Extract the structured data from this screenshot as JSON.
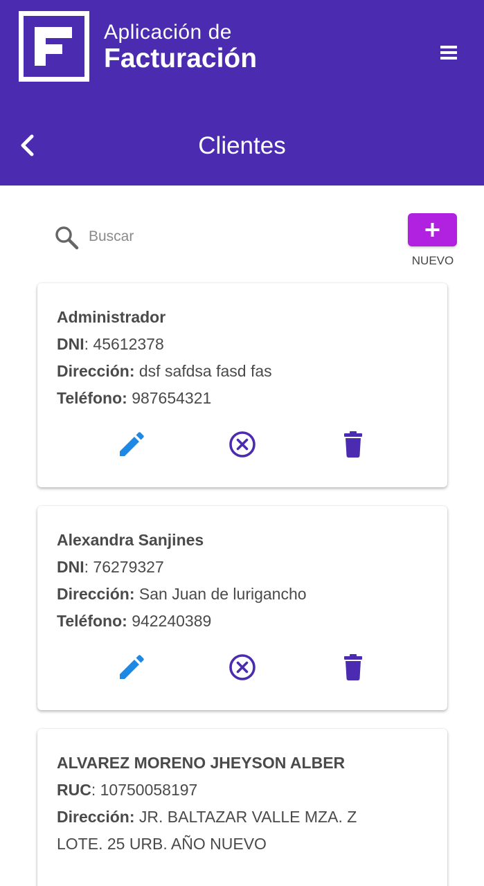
{
  "header": {
    "logo_line1": "Aplicación de",
    "logo_line2": "Facturación",
    "title": "Clientes",
    "menu_icon": "hamburger-menu-icon",
    "back_icon": "chevron-left-icon",
    "background": "#4b2bb0"
  },
  "search": {
    "placeholder": "Buscar",
    "value": "",
    "icon": "search-icon"
  },
  "new_button": {
    "label": "NUEVO",
    "icon": "plus-icon",
    "color": "#b021e0"
  },
  "clients": [
    {
      "name": "Administrador",
      "doc_label": "DNI",
      "doc_value": "45612378",
      "address_label": "Dirección:",
      "address": "dsf safdsa fasd fas",
      "phone_label": "Teléfono:",
      "phone": "987654321"
    },
    {
      "name": "Alexandra Sanjines",
      "doc_label": "DNI",
      "doc_value": "76279327",
      "address_label": "Dirección:",
      "address": "San Juan de lurigancho",
      "phone_label": "Teléfono:",
      "phone": "942240389"
    },
    {
      "name": "ALVAREZ MORENO JHEYSON ALBER",
      "doc_label": "RUC",
      "doc_value": "10750058197",
      "address_label": "Dirección:",
      "address": "JR. BALTAZAR VALLE MZA. Z LOTE. 25 URB. AÑO NUEVO"
    }
  ],
  "actions": {
    "edit_icon": "pencil-edit-icon",
    "deactivate_icon": "circle-x-icon",
    "delete_icon": "trash-icon",
    "edit_color": "#1e88e5",
    "action_color": "#4b2bb0"
  }
}
